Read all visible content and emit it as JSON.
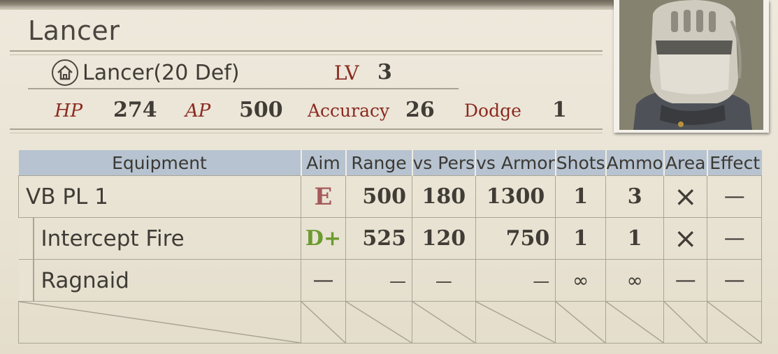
{
  "unit": {
    "name": "Lancer",
    "class_name": "Lancer(20 Def)",
    "lv_label": "LV",
    "lv": "3"
  },
  "stats": {
    "hp_label": "HP",
    "hp": "274",
    "ap_label": "AP",
    "ap": "500",
    "accuracy_label": "Accuracy",
    "accuracy": "26",
    "dodge_label": "Dodge",
    "dodge": "1"
  },
  "table": {
    "headers": [
      "Equipment",
      "Aim",
      "Range",
      "vs Pers",
      "vs Armor",
      "Shots",
      "Ammo",
      "Area",
      "Effect"
    ],
    "rows": [
      {
        "name": "VB PL 1",
        "aim": "E",
        "aim_color": "#a55a5a",
        "range": "500",
        "vs_pers": "180",
        "vs_armor": "1300",
        "shots": "1",
        "ammo": "3",
        "area": "×",
        "effect": "—"
      },
      {
        "name": "Intercept Fire",
        "aim": "D+",
        "aim_color": "#6c9a2f",
        "range": "525",
        "vs_pers": "120",
        "vs_armor": "750",
        "shots": "1",
        "ammo": "1",
        "area": "×",
        "effect": "—"
      },
      {
        "name": "Ragnaid",
        "aim": "—",
        "range": "—",
        "vs_pers": "—",
        "vs_armor": "—",
        "shots": "∞",
        "ammo": "∞",
        "area": "—",
        "effect": "—"
      }
    ]
  },
  "colors": {
    "label_red": "#8b2a1f",
    "header_blue": "#b7c3d0",
    "paper": "#e9e3d4"
  },
  "icons": {
    "class": "house-icon",
    "portrait": "knight-helmet-portrait"
  }
}
